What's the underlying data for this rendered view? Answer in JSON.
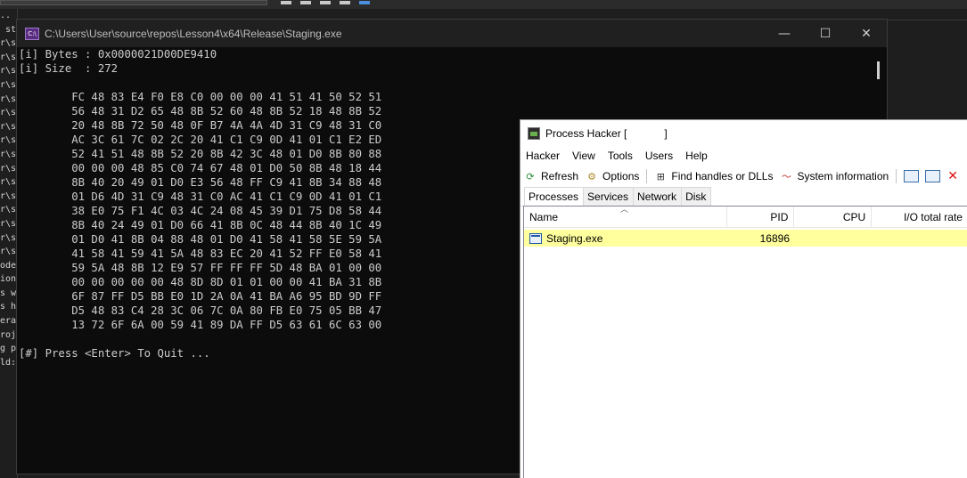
{
  "background_ide": {
    "output_fragments": [
      "..",
      " st",
      "",
      "r\\s",
      "r\\s",
      "r\\s",
      "r\\s",
      "r\\s",
      "r\\s",
      "r\\s",
      "r\\s",
      "r\\s",
      "r\\s",
      "r\\s",
      "r\\s",
      "r\\s",
      "r\\s",
      "r\\s",
      "r\\s",
      "ode",
      "ion",
      "s w",
      "s h",
      "era",
      "roj",
      "g p",
      "ld:"
    ]
  },
  "console": {
    "title": "C:\\Users\\User\\source\\repos\\Lesson4\\x64\\Release\\Staging.exe",
    "icon_text": "C:\\",
    "bytes_line": "[i] Bytes : 0x0000021D00DE9410",
    "size_line": "[i] Size  : 272",
    "hex_lines": [
      "        FC 48 83 E4 F0 E8 C0 00 00 00 41 51 41 50 52 51",
      "        56 48 31 D2 65 48 8B 52 60 48 8B 52 18 48 8B 52",
      "        20 48 8B 72 50 48 0F B7 4A 4A 4D 31 C9 48 31 C0",
      "        AC 3C 61 7C 02 2C 20 41 C1 C9 0D 41 01 C1 E2 ED",
      "        52 41 51 48 8B 52 20 8B 42 3C 48 01 D0 8B 80 88",
      "        00 00 00 48 85 C0 74 67 48 01 D0 50 8B 48 18 44",
      "        8B 40 20 49 01 D0 E3 56 48 FF C9 41 8B 34 88 48",
      "        01 D6 4D 31 C9 48 31 C0 AC 41 C1 C9 0D 41 01 C1",
      "        38 E0 75 F1 4C 03 4C 24 08 45 39 D1 75 D8 58 44",
      "        8B 40 24 49 01 D0 66 41 8B 0C 48 44 8B 40 1C 49",
      "        01 D0 41 8B 04 88 48 01 D0 41 58 41 58 5E 59 5A",
      "        41 58 41 59 41 5A 48 83 EC 20 41 52 FF E0 58 41",
      "        59 5A 48 8B 12 E9 57 FF FF FF 5D 48 BA 01 00 00",
      "        00 00 00 00 00 48 8D 8D 01 01 00 00 41 BA 31 8B",
      "        6F 87 FF D5 BB E0 1D 2A 0A 41 BA A6 95 BD 9D FF",
      "        D5 48 83 C4 28 3C 06 7C 0A 80 FB E0 75 05 BB 47",
      "        13 72 6F 6A 00 59 41 89 DA FF D5 63 61 6C 63 00"
    ],
    "quit_line": "[#] Press <Enter> To Quit ...",
    "minimize_glyph": "—",
    "maximize_glyph": "☐",
    "close_glyph": "✕"
  },
  "process_hacker": {
    "title": "Process Hacker [",
    "title_end": "]",
    "menu": [
      "Hacker",
      "View",
      "Tools",
      "Users",
      "Help"
    ],
    "toolbar": {
      "refresh": "Refresh",
      "options": "Options",
      "find_handles": "Find handles or DLLs",
      "system_information": "System information"
    },
    "tabs": [
      "Processes",
      "Services",
      "Network",
      "Disk"
    ],
    "columns": [
      "Name",
      "PID",
      "CPU",
      "I/O total rate"
    ],
    "rows": [
      {
        "name": "Staging.exe",
        "pid": "16896",
        "cpu": "",
        "io": ""
      }
    ],
    "colors": {
      "highlight": "#ffff9e"
    }
  }
}
